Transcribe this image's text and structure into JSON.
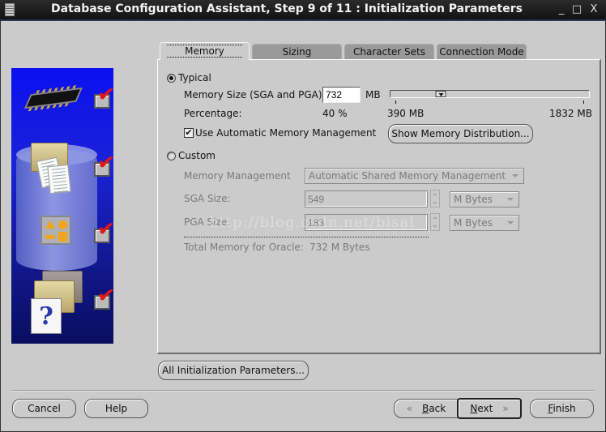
{
  "window": {
    "title": "Database Configuration Assistant, Step 9 of 11 : Initialization Parameters",
    "controls": {
      "minimize": "_",
      "maximize": "□",
      "close": "X"
    }
  },
  "steps_panel": {
    "images": [
      "memory-chip",
      "database-documents",
      "shapes-box",
      "folders-help"
    ],
    "checks": [
      true,
      true,
      true,
      true
    ]
  },
  "tabs": [
    {
      "label": "Memory",
      "active": true
    },
    {
      "label": "Sizing",
      "active": false
    },
    {
      "label": "Character Sets",
      "active": false
    },
    {
      "label": "Connection Mode",
      "active": false
    }
  ],
  "memory": {
    "typical": {
      "label": "Typical",
      "selected": true,
      "memory_size_label": "Memory Size (SGA and PGA):",
      "memory_size_value": "732",
      "memory_size_unit": "MB",
      "slider": {
        "min": 390,
        "max": 1832,
        "value": 732,
        "min_label": "390 MB",
        "max_label": "1832 MB"
      },
      "percentage_label": "Percentage:",
      "percentage_value": "40 %",
      "amm_label": "Use Automatic Memory Management",
      "amm_checked": true,
      "show_distribution_button": "Show Memory Distribution..."
    },
    "custom": {
      "label": "Custom",
      "selected": false,
      "memory_management_label": "Memory Management",
      "memory_management_value": "Automatic Shared Memory Management",
      "sga_label": "SGA Size:",
      "sga_value": "549",
      "sga_unit": "M Bytes",
      "pga_label": "PGA Size:",
      "pga_value": "183",
      "pga_unit": "M Bytes",
      "total_label": "Total Memory for Oracle:",
      "total_value": "732 M Bytes"
    },
    "watermark": "http://blog.csdn.net/bisal"
  },
  "all_params_button": "All Initialization Parameters...",
  "footer": {
    "cancel": "Cancel",
    "help": "Help",
    "back_mnemonic": "B",
    "back_rest": "ack",
    "next_mnemonic": "N",
    "next_rest": "ext",
    "finish_mnemonic": "F",
    "finish_rest": "inish"
  }
}
